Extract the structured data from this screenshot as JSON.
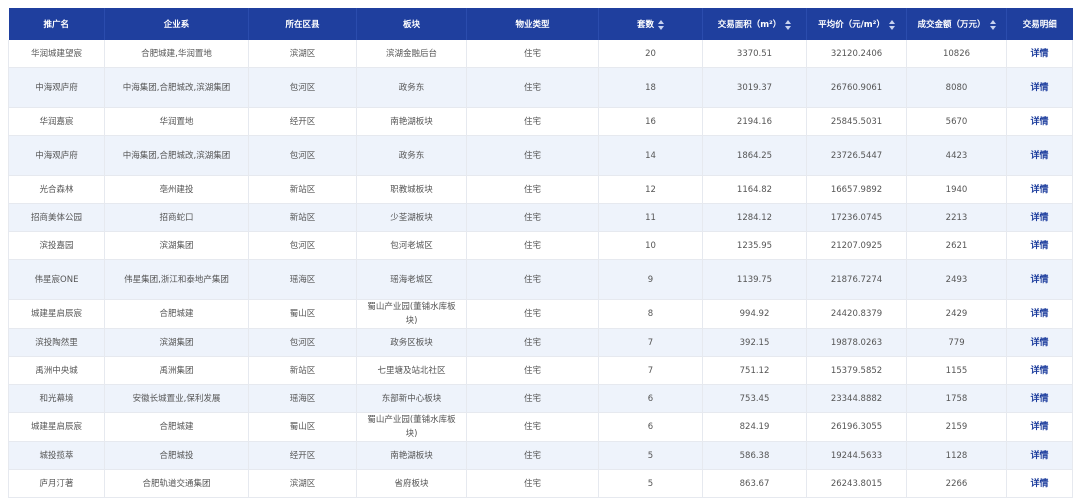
{
  "table": {
    "headers": [
      "推广名",
      "企业系",
      "所在区县",
      "板块",
      "物业类型",
      "套数",
      "交易面积（m²）",
      "平均价（元/m²）",
      "成交金额（万元）",
      "交易明细"
    ],
    "sortable": [
      false,
      false,
      false,
      false,
      false,
      true,
      true,
      true,
      true,
      false
    ],
    "rows": [
      [
        "华润城建望宸",
        "合肥城建,华润置地",
        "滨湖区",
        "滨湖金融后台",
        "住宅",
        "20",
        "3370.51",
        "32120.2406",
        "10826",
        "详情"
      ],
      [
        "中海观庐府",
        "中海集团,合肥城改,滨湖集团",
        "包河区",
        "政务东",
        "住宅",
        "18",
        "3019.37",
        "26760.9061",
        "8080",
        "详情"
      ],
      [
        "华润嘉宸",
        "华润置地",
        "经开区",
        "南艳湖板块",
        "住宅",
        "16",
        "2194.16",
        "25845.5031",
        "5670",
        "详情"
      ],
      [
        "中海观庐府",
        "中海集团,合肥城改,滨湖集团",
        "包河区",
        "政务东",
        "住宅",
        "14",
        "1864.25",
        "23726.5447",
        "4423",
        "详情"
      ],
      [
        "光合森林",
        "亳州建投",
        "新站区",
        "职教城板块",
        "住宅",
        "12",
        "1164.82",
        "16657.9892",
        "1940",
        "详情"
      ],
      [
        "招商美体公园",
        "招商蛇口",
        "新站区",
        "少荃湖板块",
        "住宅",
        "11",
        "1284.12",
        "17236.0745",
        "2213",
        "详情"
      ],
      [
        "滨投嘉园",
        "滨湖集团",
        "包河区",
        "包河老城区",
        "住宅",
        "10",
        "1235.95",
        "21207.0925",
        "2621",
        "详情"
      ],
      [
        "伟星宸ONE",
        "伟星集团,浙江和泰地产集团",
        "瑶海区",
        "瑶海老城区",
        "住宅",
        "9",
        "1139.75",
        "21876.7274",
        "2493",
        "详情"
      ],
      [
        "城建星启辰宸",
        "合肥城建",
        "蜀山区",
        "蜀山产业园(董铺水库板块)",
        "住宅",
        "8",
        "994.92",
        "24420.8379",
        "2429",
        "详情"
      ],
      [
        "滨投陶然里",
        "滨湖集团",
        "包河区",
        "政务区板块",
        "住宅",
        "7",
        "392.15",
        "19878.0263",
        "779",
        "详情"
      ],
      [
        "禹洲中央城",
        "禹洲集团",
        "新站区",
        "七里塘及站北社区",
        "住宅",
        "7",
        "751.12",
        "15379.5852",
        "1155",
        "详情"
      ],
      [
        "和光幕境",
        "安徽长城置业,保利发展",
        "瑶海区",
        "东部新中心板块",
        "住宅",
        "6",
        "753.45",
        "23344.8882",
        "1758",
        "详情"
      ],
      [
        "城建星启辰宸",
        "合肥城建",
        "蜀山区",
        "蜀山产业园(董铺水库板块)",
        "住宅",
        "6",
        "824.19",
        "26196.3055",
        "2159",
        "详情"
      ],
      [
        "城投揽萃",
        "合肥城投",
        "经开区",
        "南艳湖板块",
        "住宅",
        "5",
        "586.38",
        "19244.5633",
        "1128",
        "详情"
      ],
      [
        "庐月汀著",
        "合肥轨道交通集团",
        "滨湖区",
        "省府板块",
        "住宅",
        "5",
        "863.67",
        "26243.8015",
        "2266",
        "详情"
      ]
    ]
  }
}
